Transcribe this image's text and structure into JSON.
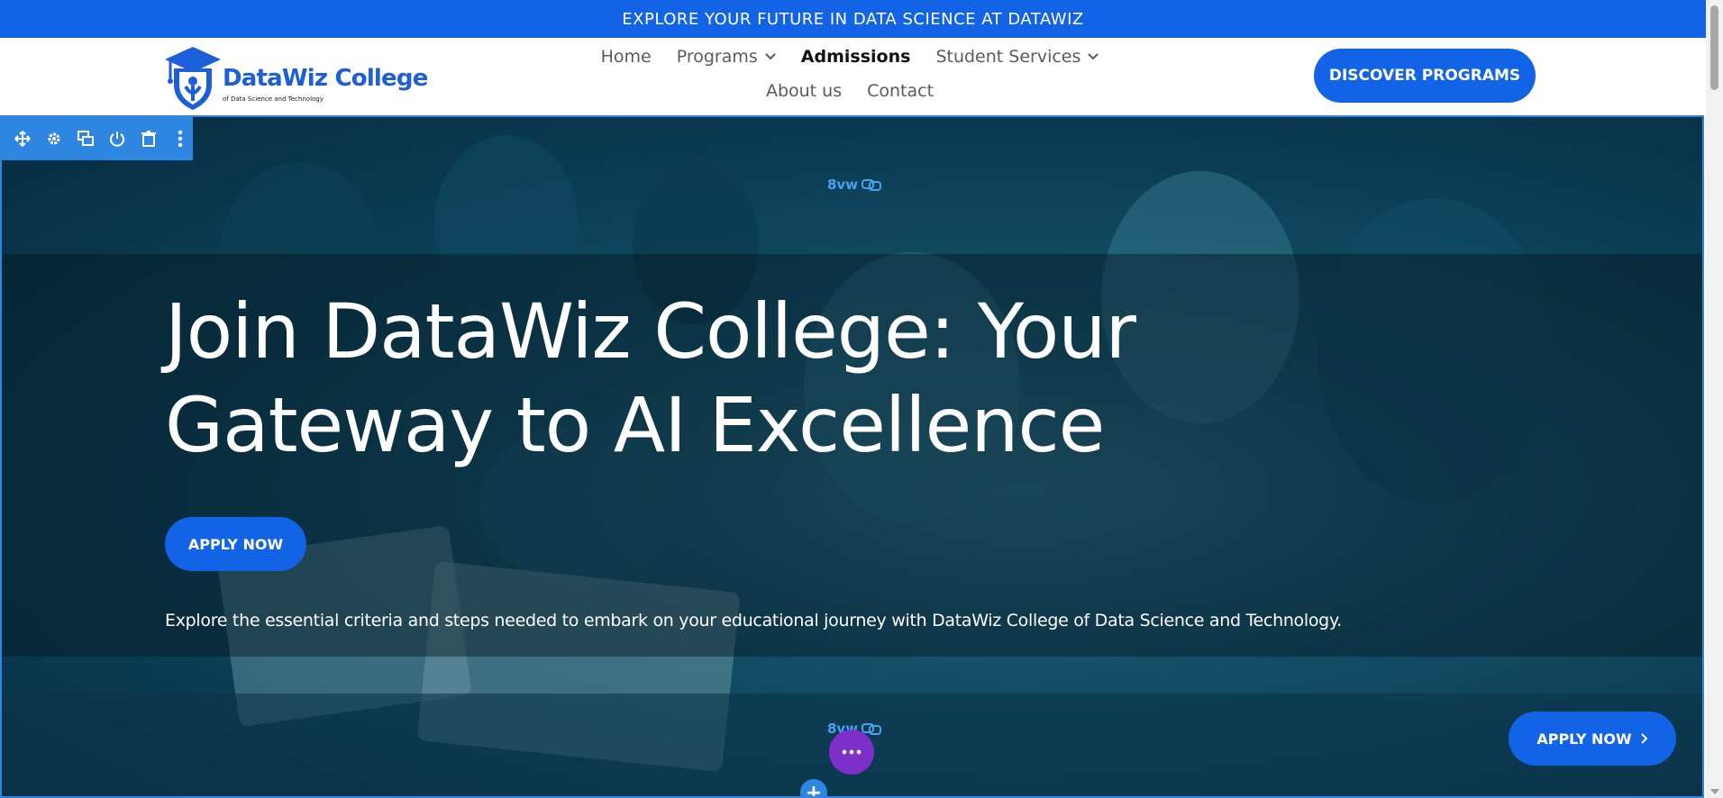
{
  "announcement": {
    "text": "EXPLORE YOUR FUTURE IN DATA SCIENCE AT DATAWIZ"
  },
  "logo": {
    "name": "DataWiz College",
    "tagline": "of Data Science and Technology"
  },
  "nav": {
    "items": [
      {
        "label": "Home"
      },
      {
        "label": "Programs"
      },
      {
        "label": "Admissions"
      },
      {
        "label": "Student Services"
      },
      {
        "label": "About us"
      },
      {
        "label": "Contact"
      }
    ],
    "active": "Admissions"
  },
  "header": {
    "cta_label": "DISCOVER PROGRAMS"
  },
  "editor": {
    "tools": [
      "move-icon",
      "gear-icon",
      "duplicate-icon",
      "power-icon",
      "trash-icon",
      "more-vertical-icon"
    ],
    "spacing_top": "8vw",
    "spacing_bottom": "8vw"
  },
  "hero": {
    "title": "Join DataWiz College: Your Gateway to AI Excellence",
    "apply_label": "APPLY NOW",
    "description": "Explore the essential criteria and steps needed to embark on your educational journey with DataWiz College of Data Science and Technology.",
    "floating_apply_label": "APPLY NOW"
  },
  "colors": {
    "brand_blue": "#1263e6",
    "editor_blue": "#2f86e0",
    "fab_purple": "#7c2fc9"
  }
}
